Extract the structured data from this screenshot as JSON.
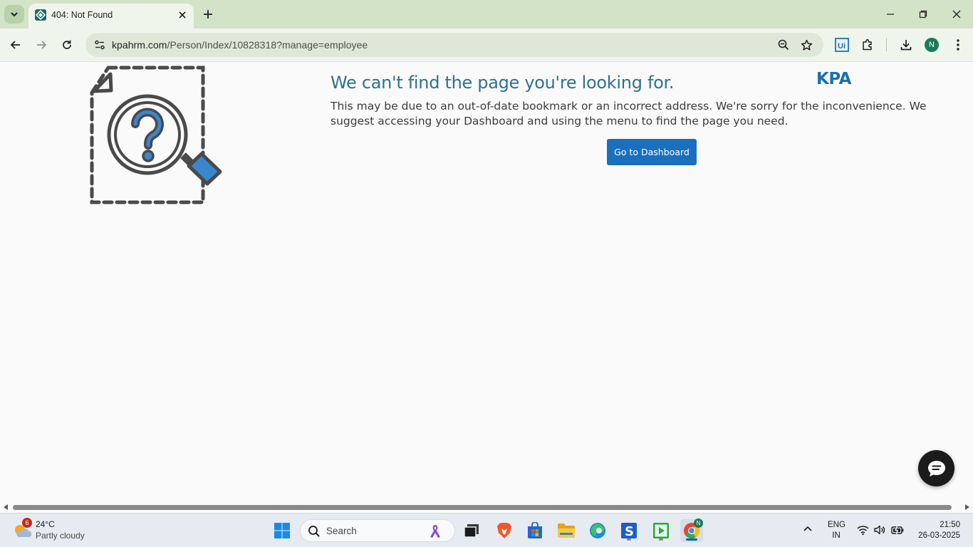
{
  "browser": {
    "tab": {
      "title": "404: Not Found"
    },
    "url": {
      "host": "kpahrm.com",
      "path": "/Person/Index/10828318?manage=employee"
    },
    "profile_initial": "N"
  },
  "page": {
    "logo_text": "KPA",
    "heading": "We can't find the page you're looking for.",
    "message": "This may be due to an out-of-date bookmark or an incorrect address. We're sorry for the inconvenience. We suggest accessing your Dashboard and using the menu to find the page you need.",
    "dashboard_button": "Go to Dashboard"
  },
  "taskbar": {
    "weather": {
      "temp": "24°C",
      "condition": "Partly cloudy",
      "badge": "6"
    },
    "search_placeholder": "Search",
    "chrome_badge": "N",
    "language": {
      "line1": "ENG",
      "line2": "IN"
    },
    "clock": {
      "time": "21:50",
      "date": "26-03-2025"
    }
  },
  "colors": {
    "tab_strip": "#d3e3c8",
    "heading": "#2e7191",
    "button": "#1a70bd",
    "logo": "#1d6fb0"
  }
}
